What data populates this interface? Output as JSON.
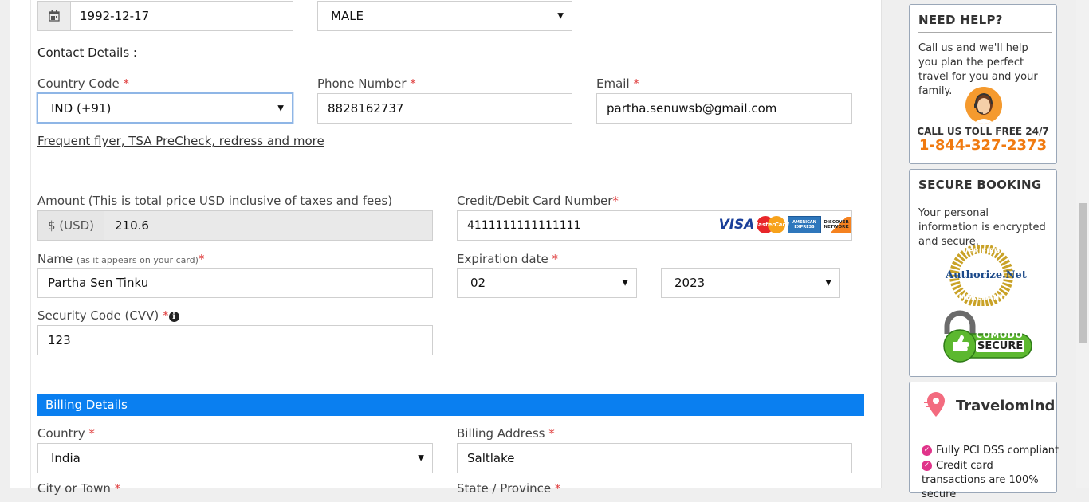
{
  "dob": {
    "value": "1992-12-17"
  },
  "gender": {
    "value": "MALE"
  },
  "contact": {
    "heading": "Contact Details :",
    "country_code_label": "Country Code",
    "country_code_value": "IND (+91)",
    "phone_label": "Phone Number",
    "phone_value": "8828162737",
    "email_label": "Email",
    "email_value": "partha.senuwsb@gmail.com",
    "frequent_flyer_link": "Frequent flyer, TSA PreCheck, redress and more"
  },
  "payment": {
    "amount_label": "Amount (This is total price USD inclusive of taxes and fees)",
    "currency_addon": "$ (USD)",
    "amount_value": "210.6",
    "card_number_label": "Credit/Debit Card Number",
    "card_number_value": "4111111111111111",
    "card_logos": [
      "VISA",
      "MasterCard",
      "AMERICAN EXPRESS",
      "DISCOVER NETWORK"
    ],
    "name_label": "Name",
    "name_hint": "(as it appears on your card)",
    "name_value": "Partha Sen Tinku",
    "expiration_label": "Expiration date",
    "exp_month": "02",
    "exp_year": "2023",
    "cvv_label": "Security Code (CVV)",
    "cvv_value": "123"
  },
  "billing": {
    "heading": "Billing Details",
    "country_label": "Country",
    "country_value": "India",
    "address_label": "Billing Address",
    "address_value": "Saltlake",
    "city_label": "City or Town",
    "state_label": "State / Province"
  },
  "required_mark": "*",
  "sidebar": {
    "help_title": "NEED HELP?",
    "help_text": "Call us and we'll help you plan the perfect travel for you and your family.",
    "toll_free_label": "CALL US TOLL FREE 24/7",
    "phone": "1-844-327-2373",
    "secure_title": "SECURE BOOKING",
    "secure_text": "Your personal information is encrypted and secure.",
    "authorize_top": "VERIFIED",
    "authorize_name": "Authorize.Net",
    "authorize_bottom": "MERCHANT",
    "comodo_top": "COMODO",
    "comodo_bottom": "SECURE",
    "brand_name": "Travelomind",
    "feature_1": "Fully PCI DSS compliant",
    "feature_2": "Credit card transactions are 100% secure"
  },
  "colors": {
    "accent_bar": "#0a7ff0",
    "phone_orange": "#f07a10",
    "required_red": "#e04040",
    "brand_pink": "#e0338a"
  }
}
